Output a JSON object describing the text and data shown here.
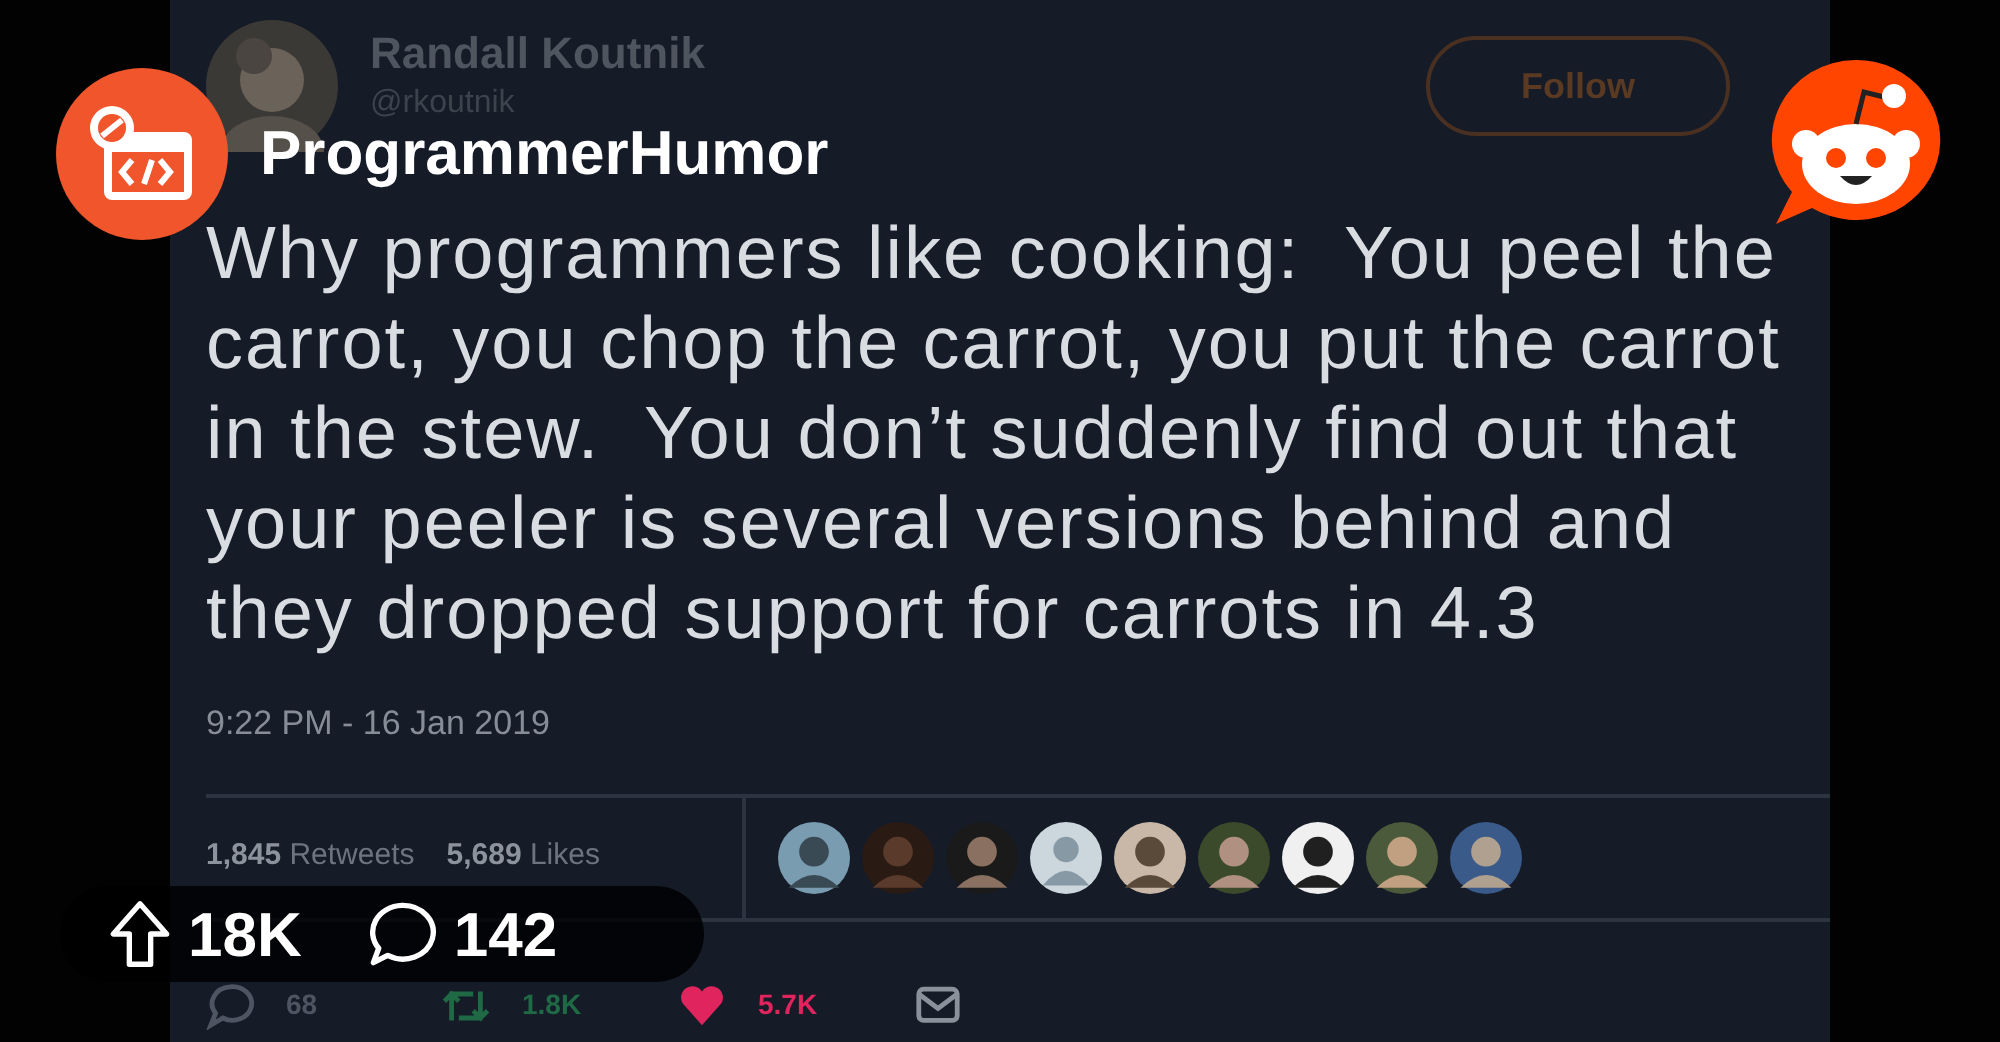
{
  "subreddit": {
    "name": "ProgrammerHumor"
  },
  "tweet": {
    "author": "Randall Koutnik",
    "handle": "@rkoutnik",
    "follow_button": "Follow",
    "text_lines": [
      "Why programmers like cooking:  You peel the",
      "carrot, you chop the carrot, you put the carrot",
      "in the stew.  You don’t suddenly find out that",
      "your peeler is several versions behind and",
      "they dropped support for carrots in 4.3"
    ],
    "timestamp": "9:22 PM - 16 Jan 2019",
    "stats": [
      {
        "count": "1,845",
        "label": "Retweets"
      },
      {
        "count": "5,689",
        "label": "Likes"
      }
    ],
    "liker_avatars": [
      {
        "kind": "picture"
      },
      {
        "kind": "picture"
      },
      {
        "kind": "picture"
      },
      {
        "kind": "default"
      },
      {
        "kind": "picture"
      },
      {
        "kind": "picture"
      },
      {
        "kind": "picture"
      },
      {
        "kind": "picture"
      },
      {
        "kind": "picture"
      }
    ],
    "actions": [
      {
        "kind": "reply",
        "count": "68"
      },
      {
        "kind": "retweet",
        "count": "1.8K"
      },
      {
        "kind": "like",
        "count": "5.7K"
      },
      {
        "kind": "message"
      }
    ]
  },
  "post_stats": {
    "upvotes": "18K",
    "comments": "142"
  }
}
